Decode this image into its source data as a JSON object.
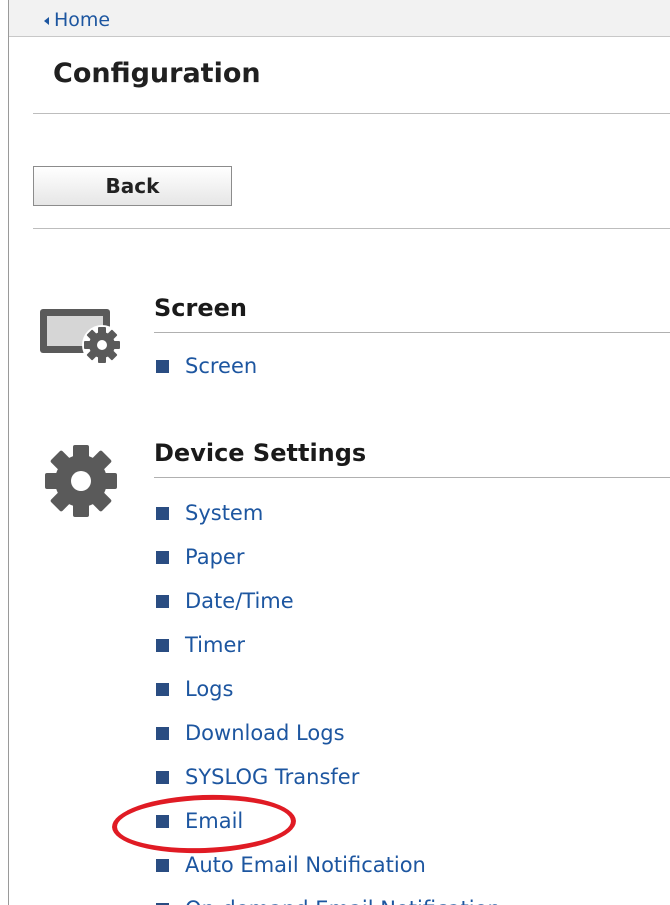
{
  "topbar": {
    "home_label": "Home"
  },
  "page": {
    "title": "Configuration",
    "back_label": "Back"
  },
  "sections": [
    {
      "title": "Screen",
      "icon": "screen-settings-icon",
      "items": [
        "Screen"
      ]
    },
    {
      "title": "Device Settings",
      "icon": "gear-icon",
      "items": [
        "System",
        "Paper",
        "Date/Time",
        "Timer",
        "Logs",
        "Download Logs",
        "SYSLOG Transfer",
        "Email",
        "Auto Email Notification",
        "On-demand Email Notification"
      ]
    }
  ],
  "annotation": {
    "highlighted_item": "Email",
    "color": "#e01b24"
  },
  "colors": {
    "link": "#1d56a0",
    "bullet": "#2a4d82"
  }
}
